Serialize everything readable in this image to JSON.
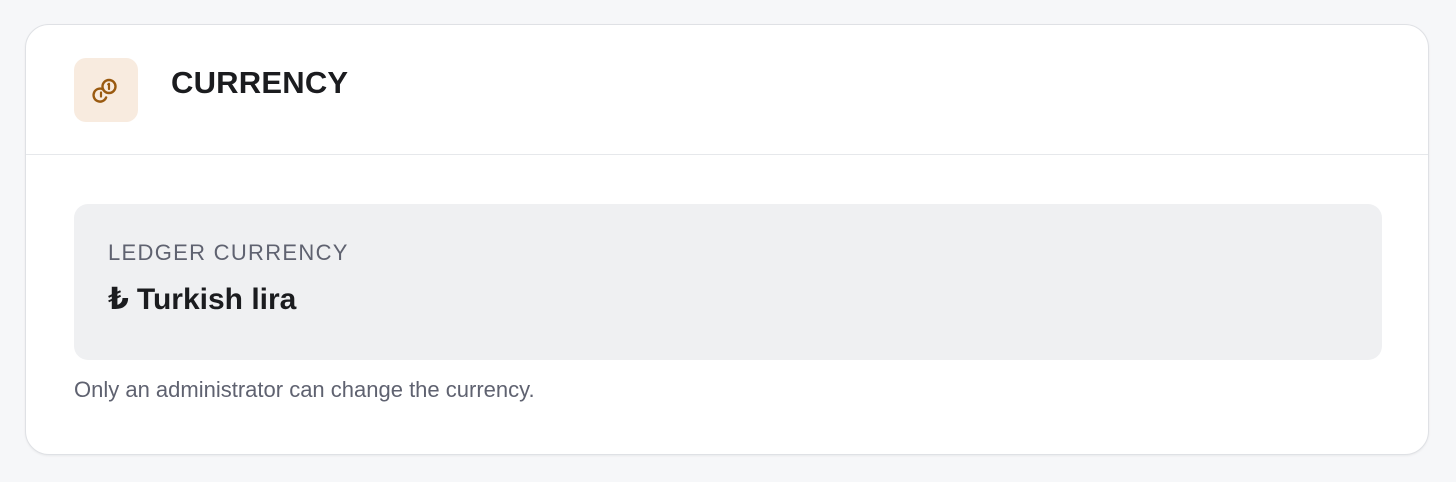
{
  "card": {
    "title": "CURRENCY",
    "icon": "coins-icon"
  },
  "ledger": {
    "label": "LEDGER CURRENCY",
    "symbol": "₺",
    "name": "Turkish lira"
  },
  "note": "Only an administrator can change the currency.",
  "colors": {
    "icon_tile_bg": "#f8ebdf",
    "icon_stroke": "#9a5a10",
    "panel_bg": "#eff0f2",
    "muted_text": "#5f6270",
    "title_text": "#1b1c1f"
  }
}
